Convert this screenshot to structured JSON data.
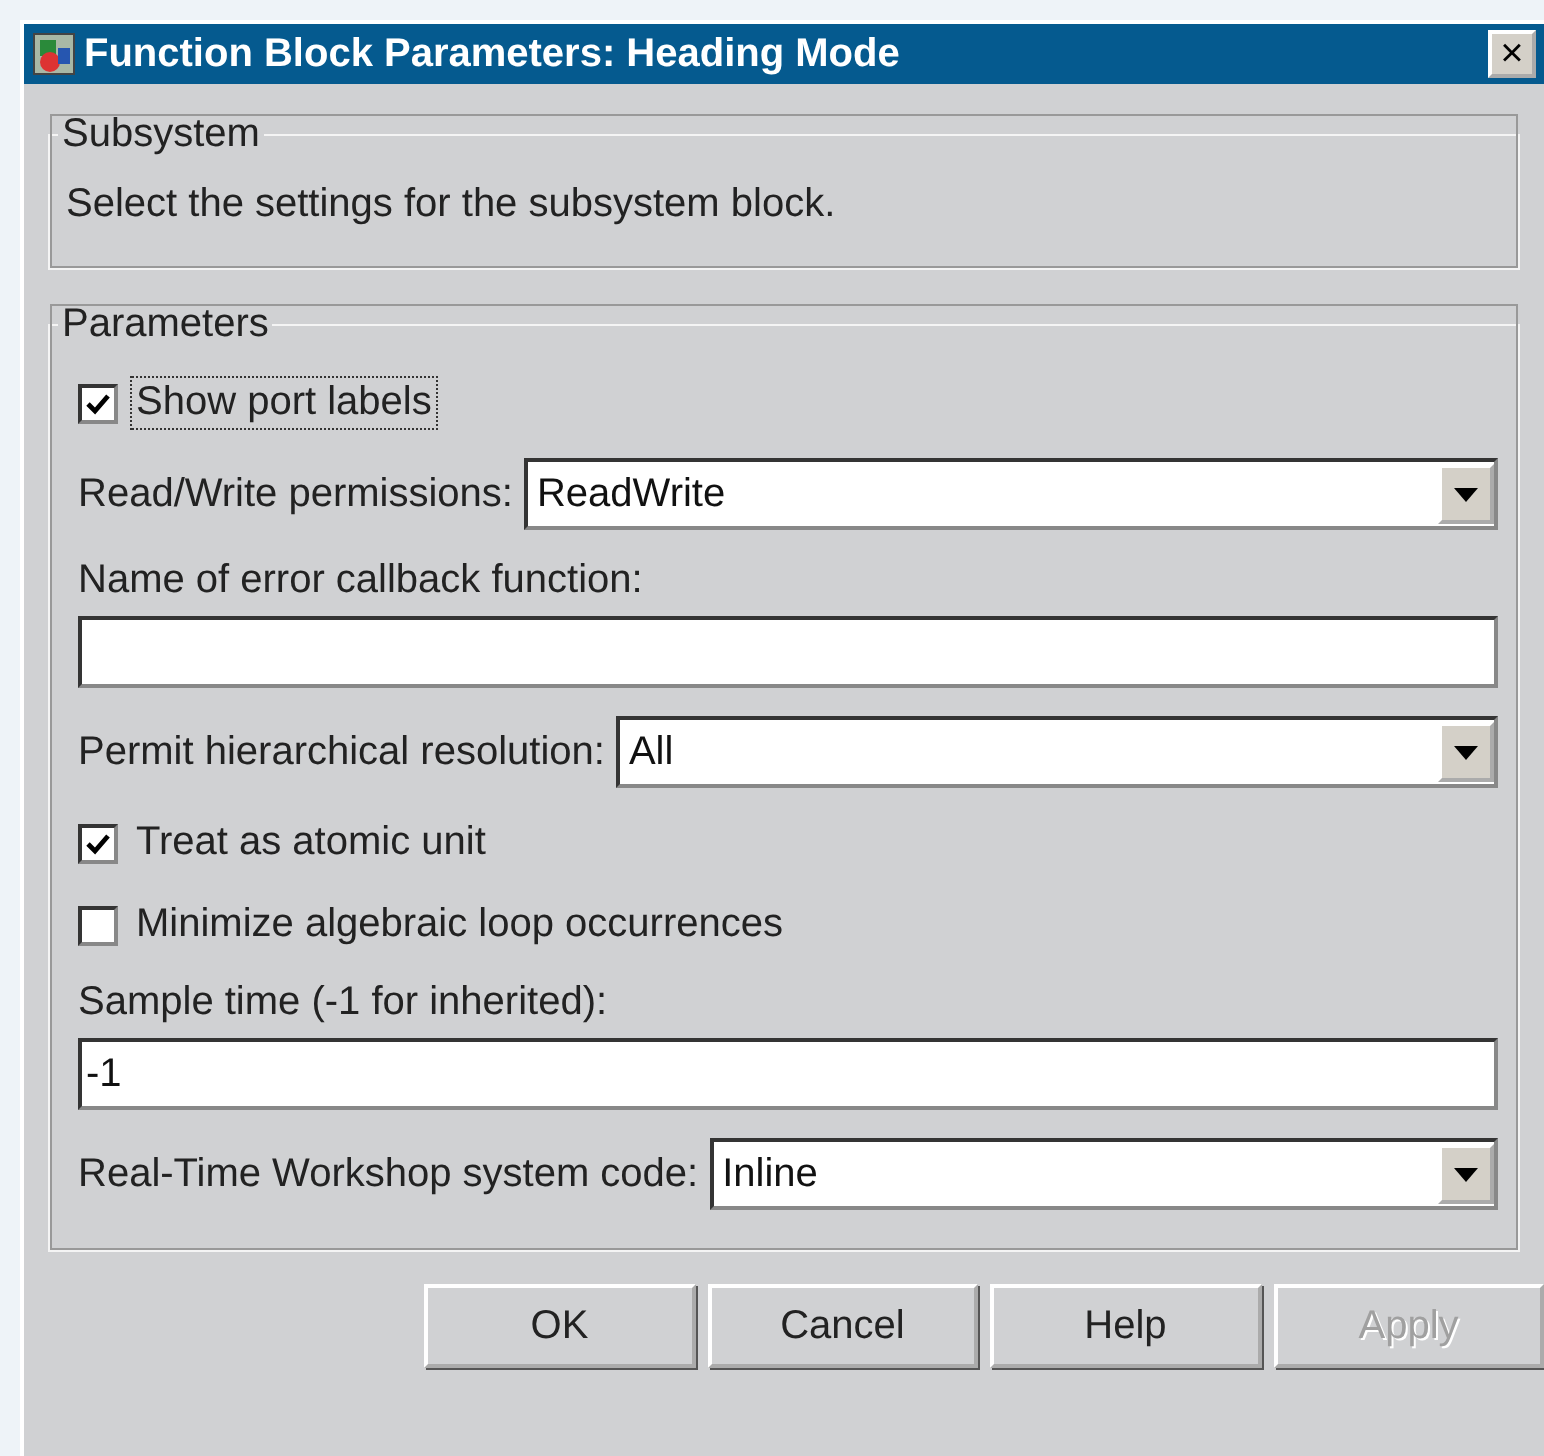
{
  "window": {
    "title": "Function Block Parameters: Heading Mode",
    "close": "×"
  },
  "subsystem": {
    "legend": "Subsystem",
    "description": "Select the settings for the subsystem block."
  },
  "parameters": {
    "legend": "Parameters",
    "items": [
      {
        "kind": "checkbox",
        "label": "Show port labels",
        "checked": true,
        "focused": true
      },
      {
        "kind": "dropdown",
        "label": "Read/Write permissions:",
        "value": "ReadWrite"
      },
      {
        "kind": "field",
        "label": "Name of error callback function:"
      },
      {
        "kind": "dropdown",
        "label": "Permit hierarchical resolution:",
        "value": "All"
      },
      {
        "kind": "checkbox",
        "label": "Treat as atomic unit",
        "checked": true,
        "focused": false
      },
      {
        "kind": "checkbox",
        "label": "Minimize algebraic loop occurrences",
        "checked": false,
        "focused": false
      },
      {
        "kind": "field",
        "label": "Sample time (-1 for inherited):",
        "value": "-1"
      },
      {
        "kind": "dropdown",
        "label": "Real-Time Workshop system code:",
        "value": "Inline"
      }
    ]
  },
  "buttons": [
    {
      "label": "OK",
      "disabled": false
    },
    {
      "label": "Cancel",
      "disabled": false
    },
    {
      "label": "Help",
      "disabled": false
    },
    {
      "label": "Apply",
      "disabled": true
    }
  ]
}
